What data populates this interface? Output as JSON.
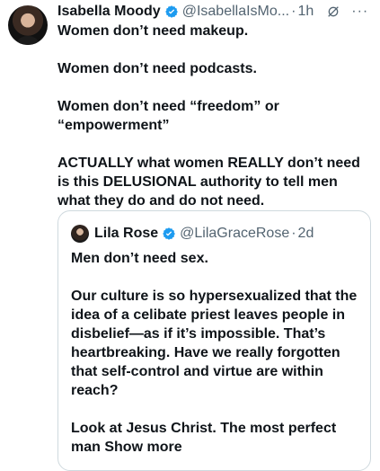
{
  "tweet": {
    "name": "Isabella Moody",
    "handle": "@IsabellaIsMo...",
    "time": "1h",
    "separator": "·",
    "more": "···",
    "text": "Women don’t need makeup.\n\nWomen don’t need podcasts.\n\nWomen don’t need “freedom” or “empowerment”\n\nACTUALLY what women REALLY don’t need is this DELUSIONAL authority to tell men what they do and do not need."
  },
  "quote": {
    "name": "Lila Rose",
    "handle": "@LilaGraceRose",
    "time": "2d",
    "separator": "·",
    "text": "Men don’t need sex.\n\nOur culture is so hypersexualized that the idea of a celibate priest leaves people in disbelief—as if it’s impossible. That’s heartbreaking. Have we really forgotten that self-control and virtue are within reach?\n\nLook at Jesus Christ. The most perfect man",
    "show_more": "Show more"
  },
  "colors": {
    "verified": "#1d9bf0",
    "secondary_text": "#536471",
    "border": "#cfd9de"
  },
  "icons": {
    "verified": "verified-badge-icon",
    "grok": "grok-icon",
    "more": "more-icon"
  }
}
